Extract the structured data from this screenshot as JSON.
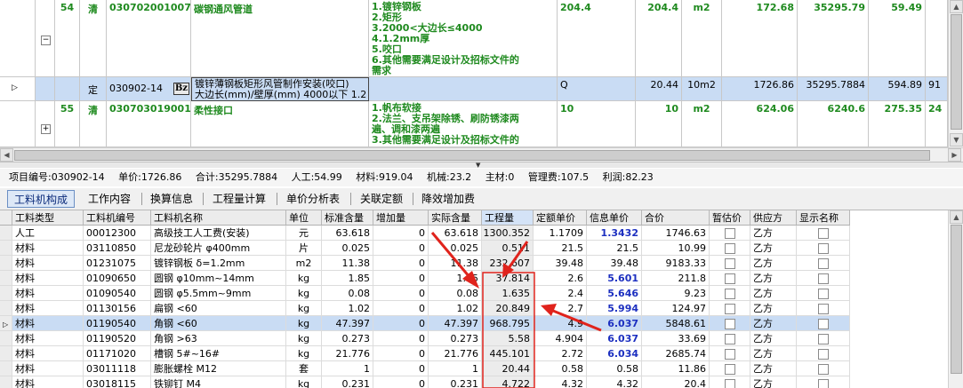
{
  "top_grid": {
    "rows": [
      {
        "no": "54",
        "type": "清",
        "code": "030702001007",
        "name": "碳钢通风管道",
        "desc": "1.镀锌钢板\n2.矩形\n3.2000<大边长≤4000\n4.1.2mm厚\n5.咬口\n6.其他需要满足设计及招标文件的\n需求",
        "qty_expr": "204.4",
        "qty": "204.4",
        "unit": "m2",
        "price": "172.68",
        "total": "35295.79",
        "extra": "59.49"
      },
      {
        "no": "",
        "type": "定",
        "code": "030902-14",
        "badge": "Bz",
        "name": "镀锌薄钢板矩形风管制作安装(咬口)\n大边长(mm)/壁厚(mm) 4000以下 1.2",
        "desc": "",
        "qty_expr": "Q",
        "qty": "20.44",
        "unit": "10m2",
        "price": "1726.86",
        "total": "35295.7884",
        "extra": "594.89",
        "extra2": "91"
      },
      {
        "no": "55",
        "type": "清",
        "code": "030703019001",
        "name": "柔性接口",
        "desc": "1.帆布软接\n2.法兰、支吊架除锈、刷防锈漆两\n遍、调和漆两遍\n3.其他需要满足设计及招标文件的",
        "qty_expr": "10",
        "qty": "10",
        "unit": "m2",
        "price": "624.06",
        "total": "6240.6",
        "extra": "275.35",
        "extra2": "24"
      }
    ]
  },
  "info_bar": {
    "item_code": "项目编号:030902-14",
    "unit_price": "单价:1726.86",
    "total": "合计:35295.7884",
    "labor": "人工:54.99",
    "material": "材料:919.04",
    "machine": "机械:23.2",
    "main_material": "主材:0",
    "management": "管理费:107.5",
    "profit": "利润:82.23"
  },
  "tabs": [
    "工料机构成",
    "工作内容",
    "换算信息",
    "工程量计算",
    "单价分析表",
    "关联定额",
    "降效增加费"
  ],
  "bottom_grid": {
    "headers": [
      "工料类型",
      "工料机编号",
      "工料机名称",
      "单位",
      "标准含量",
      "增加量",
      "实际含量",
      "工程量",
      "定额单价",
      "信息单价",
      "合价",
      "暂估价",
      "供应方",
      "显示名称"
    ],
    "rows": [
      {
        "type": "人工",
        "code": "00012300",
        "name": "高级技工人工费(安装)",
        "unit": "元",
        "std": "63.618",
        "add": "0",
        "actual": "63.618",
        "qty": "1300.352",
        "quota_price": "1.1709",
        "info_price": "1.3432",
        "info_bold": true,
        "amount": "1746.63",
        "supplier": "乙方"
      },
      {
        "type": "材料",
        "code": "03110850",
        "name": "尼龙砂轮片 φ400mm",
        "unit": "片",
        "std": "0.025",
        "add": "0",
        "actual": "0.025",
        "qty": "0.511",
        "quota_price": "21.5",
        "info_price": "21.5",
        "info_bold": false,
        "amount": "10.99",
        "supplier": "乙方"
      },
      {
        "type": "材料",
        "code": "01231075",
        "name": "镀锌钢板 δ=1.2mm",
        "unit": "m2",
        "std": "11.38",
        "add": "0",
        "actual": "11.38",
        "qty": "232.607",
        "quota_price": "39.48",
        "info_price": "39.48",
        "info_bold": false,
        "amount": "9183.33",
        "supplier": "乙方"
      },
      {
        "type": "材料",
        "code": "01090650",
        "name": "圆钢 φ10mm~14mm",
        "unit": "kg",
        "std": "1.85",
        "add": "0",
        "actual": "1.85",
        "qty": "37.814",
        "quota_price": "2.6",
        "info_price": "5.601",
        "info_bold": true,
        "amount": "211.8",
        "supplier": "乙方"
      },
      {
        "type": "材料",
        "code": "01090540",
        "name": "圆钢 φ5.5mm~9mm",
        "unit": "kg",
        "std": "0.08",
        "add": "0",
        "actual": "0.08",
        "qty": "1.635",
        "quota_price": "2.4",
        "info_price": "5.646",
        "info_bold": true,
        "amount": "9.23",
        "supplier": "乙方"
      },
      {
        "type": "材料",
        "code": "01130156",
        "name": "扁钢 <60",
        "unit": "kg",
        "std": "1.02",
        "add": "0",
        "actual": "1.02",
        "qty": "20.849",
        "quota_price": "2.7",
        "info_price": "5.994",
        "info_bold": true,
        "amount": "124.97",
        "supplier": "乙方"
      },
      {
        "type": "材料",
        "code": "01190540",
        "name": "角钢 <60",
        "unit": "kg",
        "std": "47.397",
        "add": "0",
        "actual": "47.397",
        "qty": "968.795",
        "quota_price": "4.9",
        "info_price": "6.037",
        "info_bold": true,
        "amount": "5848.61",
        "supplier": "乙方",
        "selected": true
      },
      {
        "type": "材料",
        "code": "01190520",
        "name": "角钢 >63",
        "unit": "kg",
        "std": "0.273",
        "add": "0",
        "actual": "0.273",
        "qty": "5.58",
        "quota_price": "4.904",
        "info_price": "6.037",
        "info_bold": true,
        "amount": "33.69",
        "supplier": "乙方"
      },
      {
        "type": "材料",
        "code": "01171020",
        "name": "槽钢 5#~16#",
        "unit": "kg",
        "std": "21.776",
        "add": "0",
        "actual": "21.776",
        "qty": "445.101",
        "quota_price": "2.72",
        "info_price": "6.034",
        "info_bold": true,
        "amount": "2685.74",
        "supplier": "乙方"
      },
      {
        "type": "材料",
        "code": "03011118",
        "name": "膨胀螺栓 M12",
        "unit": "套",
        "std": "1",
        "add": "0",
        "actual": "1",
        "qty": "20.44",
        "quota_price": "0.58",
        "info_price": "0.58",
        "info_bold": false,
        "amount": "11.86",
        "supplier": "乙方"
      },
      {
        "type": "材料",
        "code": "03018115",
        "name": "铁铆钉 M4",
        "unit": "kg",
        "std": "0.231",
        "add": "0",
        "actual": "0.231",
        "qty": "4.722",
        "quota_price": "4.32",
        "info_price": "4.32",
        "info_bold": false,
        "amount": "20.4",
        "supplier": "乙方"
      }
    ]
  },
  "colors": {
    "annotation_red": "#e0231c",
    "bold_blue": "#1c2fc0",
    "green_text": "#1f8a1f",
    "selected_row": "#c9dcf4"
  }
}
